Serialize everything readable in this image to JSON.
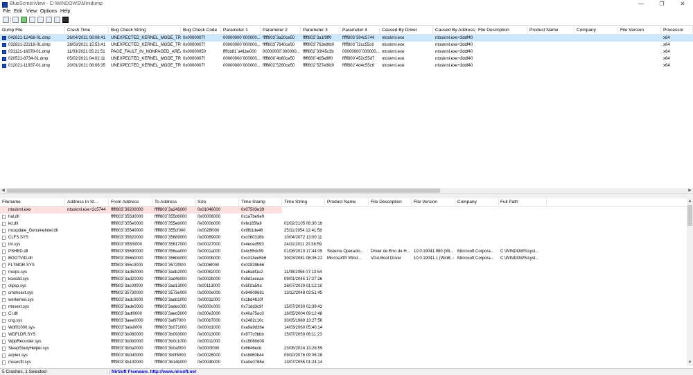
{
  "window": {
    "title": "BlueScreenView  -  C:\\WINDOWS\\Minidump",
    "controls": [
      "—",
      "❐",
      "✕"
    ]
  },
  "menu": [
    "File",
    "Edit",
    "View",
    "Options",
    "Help"
  ],
  "toolbar": {
    "icons": [
      "properties-icon",
      "save-icon",
      "refresh-icon",
      "copy-icon",
      "html-report-icon",
      "find-icon",
      "about-icon",
      "exit-icon"
    ]
  },
  "dumps": {
    "columns": [
      "Dump File",
      "Crash Time",
      "Bug Check String",
      "Bug Check Code",
      "Parameter 1",
      "Parameter 2",
      "Parameter 3",
      "Parameter 4",
      "Caused By Driver",
      "Caused By Address",
      "File Description",
      "Product Name",
      "Company",
      "File Version",
      "Processor"
    ],
    "rows": [
      [
        "042621-12468-01.dmp",
        "26/04/2021 08:08:41",
        "UNEXPECTED_KERNEL_MODE_TRAP",
        "0x0000007f",
        "00000000`000000...",
        "fffff803`3a20ce50",
        "fffff803`3a1f0ff0",
        "fffff803`394c5744",
        "ntoskrnl.exe",
        "ntoskrnl.exe+3ddf40",
        "",
        "",
        "",
        "",
        "x64"
      ],
      [
        "032821-22218-01.dmp",
        "28/03/2021 15:53:41",
        "UNEXPECTED_KERNEL_MODE_TRAP",
        "0x0000007f",
        "00000000`000000...",
        "fffff803`7640ce50",
        "fffff803`763e8fd0",
        "fffff803`72cc55c6",
        "ntoskrnl.exe",
        "ntoskrnl.exe+3ddf40",
        "",
        "",
        "",
        "",
        "x64"
      ],
      [
        "031121-16078-01.dmp",
        "11/03/2021 05:21:51",
        "PAGE_FAULT_IN_NONPAGED_AREA",
        "0x00000050",
        "ffffcb81`a41be000",
        "00000000`000000...",
        "fffff802`33f45c3b",
        "00000000`000000...",
        "ntoskrnl.exe",
        "ntoskrnl.exe+3ddf40",
        "",
        "",
        "",
        "",
        "x64"
      ],
      [
        "020521-8734-01.dmp",
        "05/02/2021 04:02:11",
        "UNEXPECTED_KERNEL_MODE_TRAP",
        "0x0000007f",
        "00000000`000000...",
        "fffff800`4b60ce50",
        "fffff800`4b5e8ff0",
        "fffff800`452c55d7",
        "ntoskrnl.exe",
        "ntoskrnl.exe+3ddf40",
        "",
        "",
        "",
        "",
        "x64"
      ],
      [
        "012021-11937-01.dmp",
        "20/01/2021 08:06:35",
        "UNEXPECTED_KERNEL_MODE_TRAP",
        "0x0000007f",
        "00000000`000000...",
        "fffff802`5280ce50",
        "fffff802`527e8fd0",
        "fffff802`4d4c55c6",
        "ntoskrnl.exe",
        "ntoskrnl.exe+3ddf40",
        "",
        "",
        "",
        "",
        "x64"
      ]
    ]
  },
  "drivers": {
    "columns": [
      "Filename",
      "Address In St...",
      "From Address",
      "To Address",
      "Size",
      "Time Stamp",
      "Time String",
      "Product Name",
      "File Description",
      "File Version",
      "Company",
      "Full Path"
    ],
    "rows": [
      [
        "ntoskrnl.exe",
        "ntoskrnl.exe+2c5744",
        "fffff803`39200000",
        "fffff803`3a246000",
        "0x01046000",
        "0x07503e39",
        "",
        "",
        "",
        "",
        "",
        ""
      ],
      [
        "hal.dll",
        "",
        "fffff803`355d0000",
        "fffff803`355d6000",
        "0x00006000",
        "0x1a7be9e9",
        "",
        "",
        "",
        "",
        "",
        ""
      ],
      [
        "kd.dll",
        "",
        "fffff803`355e0000",
        "fffff803`355eb000",
        "0x0000b000",
        "0xfe185fa8",
        "02/02/2105 06:30:16",
        "",
        "",
        "",
        "",
        ""
      ],
      [
        "mcupdate_GenuineIntel.dll",
        "",
        "fffff803`35540000",
        "fffff803`355cf000",
        "0x0028f000",
        "0x9fb1de46",
        "25/11/2054 12:41:58",
        "",
        "",
        "",
        "",
        ""
      ],
      [
        "CLFS.SYS",
        "",
        "fffff803`35620000",
        "fffff803`35689000",
        "0x00069000",
        "0xc060318b",
        "10/04/2072 13:00:11",
        "",
        "",
        "",
        "",
        ""
      ],
      [
        "tm.sys",
        "",
        "fffff803`355f0000",
        "fffff803`35617000",
        "0x00027000",
        "0x4eced593",
        "24/11/2011 20:38:59",
        "",
        "",
        "",
        "",
        ""
      ],
      [
        "PSHED.dll",
        "",
        "fffff803`35690000",
        "fffff803`356aa000",
        "0x0001a000",
        "0x4c55dc99",
        "01/08/2010 17:44:09",
        "Sistema Operacio...",
        "Driver de Erro de H...",
        "10.0.19041.980 (Wi...",
        "Microsoft Corpora...",
        "C:\\WINDOWS\\syst..."
      ],
      [
        "BOOTVID.dll",
        "",
        "fffff803`356b0000",
        "fffff803`356bb000",
        "0x0000b000",
        "0xcd13ee5b6",
        "30/03/2081 08:36:22",
        "Microsoft® Wind...",
        "VGA Boot Driver",
        "10.0.19041.1 (WinB...",
        "Microsoft Corpora...",
        "C:\\WINDOWS\\syst..."
      ],
      [
        "FLTMGR.SYS",
        "",
        "fffff803`356c0000",
        "fffff803`3572f000",
        "0x0006f000",
        "0x02839b66",
        "",
        "",
        "",
        "",
        "",
        ""
      ],
      [
        "msrpc.sys",
        "",
        "fffff803`3ad50000",
        "fffff803`3adb2000",
        "0x00062000",
        "0xa6abf1e2",
        "11/08/2058 07:13:54",
        "",
        "",
        "",
        "",
        ""
      ],
      [
        "ksecdd.sys",
        "",
        "fffff803`3ad20000",
        "fffff803`3ad4b000",
        "0x0002b000",
        "0x8d1eceae",
        "09/01/2045 17:27:26",
        "",
        "",
        "",
        "",
        ""
      ],
      [
        "clipsp.sys",
        "",
        "fffff803`3ac00000",
        "fffff803`3ad13000",
        "0x00113000",
        "0x5f1fa59a",
        "28/07/2020 01:12:10",
        "",
        "",
        "",
        "",
        ""
      ],
      [
        "cmimcext.sys",
        "",
        "fffff803`35730000",
        "fffff803`3573e000",
        "0x0000e000",
        "0x94809681",
        "13/12/2048 03:51:45",
        "",
        "",
        "",
        "",
        ""
      ],
      [
        "werkernel.sys",
        "",
        "fffff803`3adc0000",
        "fffff803`3add1000",
        "0x00011000",
        "0x1bd4610f",
        "",
        "",
        "",
        "",
        "",
        ""
      ],
      [
        "ntosext.sys",
        "",
        "fffff803`3ade0000",
        "fffff803`3adec000",
        "0x0000c000",
        "0x71dd3c9f",
        "15/07/2030 02:39:43",
        "",
        "",
        "",
        "",
        ""
      ],
      [
        "CI.dll",
        "",
        "fffff803`3adf0000",
        "fffff803`3aed3000",
        "0x000e3000",
        "0x40a75ec0",
        "16/05/2004 09:12:48",
        "",
        "",
        "",
        "",
        ""
      ],
      [
        "cng.sys",
        "",
        "fffff803`3aee0000",
        "fffff803`3af97000",
        "0x000b7000",
        "0x2482c10c",
        "30/05/1989 13:27:56",
        "",
        "",
        "",
        "",
        ""
      ],
      [
        "Wdf01000.sys",
        "",
        "fffff803`3afa0000",
        "fffff803`3b071000",
        "0x000d1000",
        "0xa9a9d36e",
        "14/03/2060 05:40:14",
        "",
        "",
        "",
        "",
        ""
      ],
      [
        "WDFLDR.SYS",
        "",
        "fffff803`3b080000",
        "fffff803`3b093000",
        "0x00013000",
        "0x977c0bbb",
        "15/07/2050 06:11:23",
        "",
        "",
        "",
        "",
        ""
      ],
      [
        "WppRecorder.sys",
        "",
        "fffff803`3b0b0000",
        "fffff803`3b0c1000",
        "0x00011000",
        "0x15060d00",
        "",
        "",
        "",
        "",
        "",
        ""
      ],
      [
        "SleepStudyHelper.sys",
        "",
        "fffff803`3b0a0000",
        "fffff803`3b0af000",
        "0x0000f000",
        "0x6646ecb",
        "23/05/2024 13:28:59",
        "",
        "",
        "",
        "",
        ""
      ],
      [
        "acpiex.sys",
        "",
        "fffff803`3b0d0000",
        "fffff803`3b0f6000",
        "0x00026000",
        "0xc8d60b44",
        "09/10/2076 09:06:28",
        "",
        "",
        "",
        "",
        ""
      ],
      [
        "mssecflt.sys",
        "",
        "fffff803`3b100000",
        "fffff803`3b14b000",
        "0x0004b000",
        "0xa0e0786e",
        "13/07/2055 01:24:14",
        "",
        "",
        "",
        "",
        ""
      ]
    ]
  },
  "status": {
    "left": "5 Crashes, 1 Selected",
    "middle": "NirSoft Freeware.  http://www.nirsoft.net"
  },
  "colors": {
    "selected_row": "#cce8ff",
    "highlight_row": "#fde0e0",
    "status_link": "#0000cc"
  }
}
